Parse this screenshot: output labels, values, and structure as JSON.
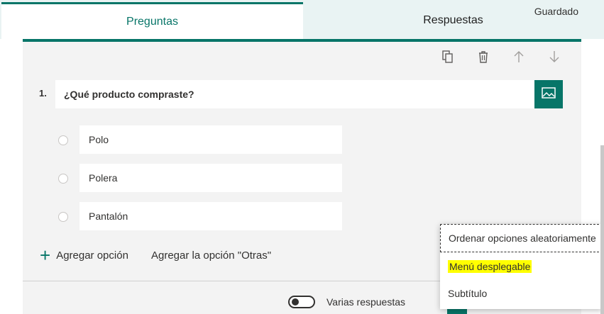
{
  "tabs": {
    "questions": "Preguntas",
    "responses": "Respuestas"
  },
  "status": "Guardado",
  "question": {
    "number": "1.",
    "text": "¿Qué producto compraste?"
  },
  "options": [
    "Polo",
    "Polera",
    "Pantalón"
  ],
  "actions": {
    "add_option": "Agregar opción",
    "add_other": "Agregar la opción \"Otras\""
  },
  "footer": {
    "multiple_answers": "Varias respuestas"
  },
  "context_menu": {
    "items": [
      "Ordenar opciones aleatoriamente",
      "Menú desplegable",
      "Subtítulo"
    ]
  },
  "colors": {
    "accent": "#077568",
    "highlight": "#ffff00"
  },
  "icons": [
    "copy-icon",
    "delete-icon",
    "move-up-icon",
    "move-down-icon",
    "image-icon",
    "plus-icon"
  ]
}
